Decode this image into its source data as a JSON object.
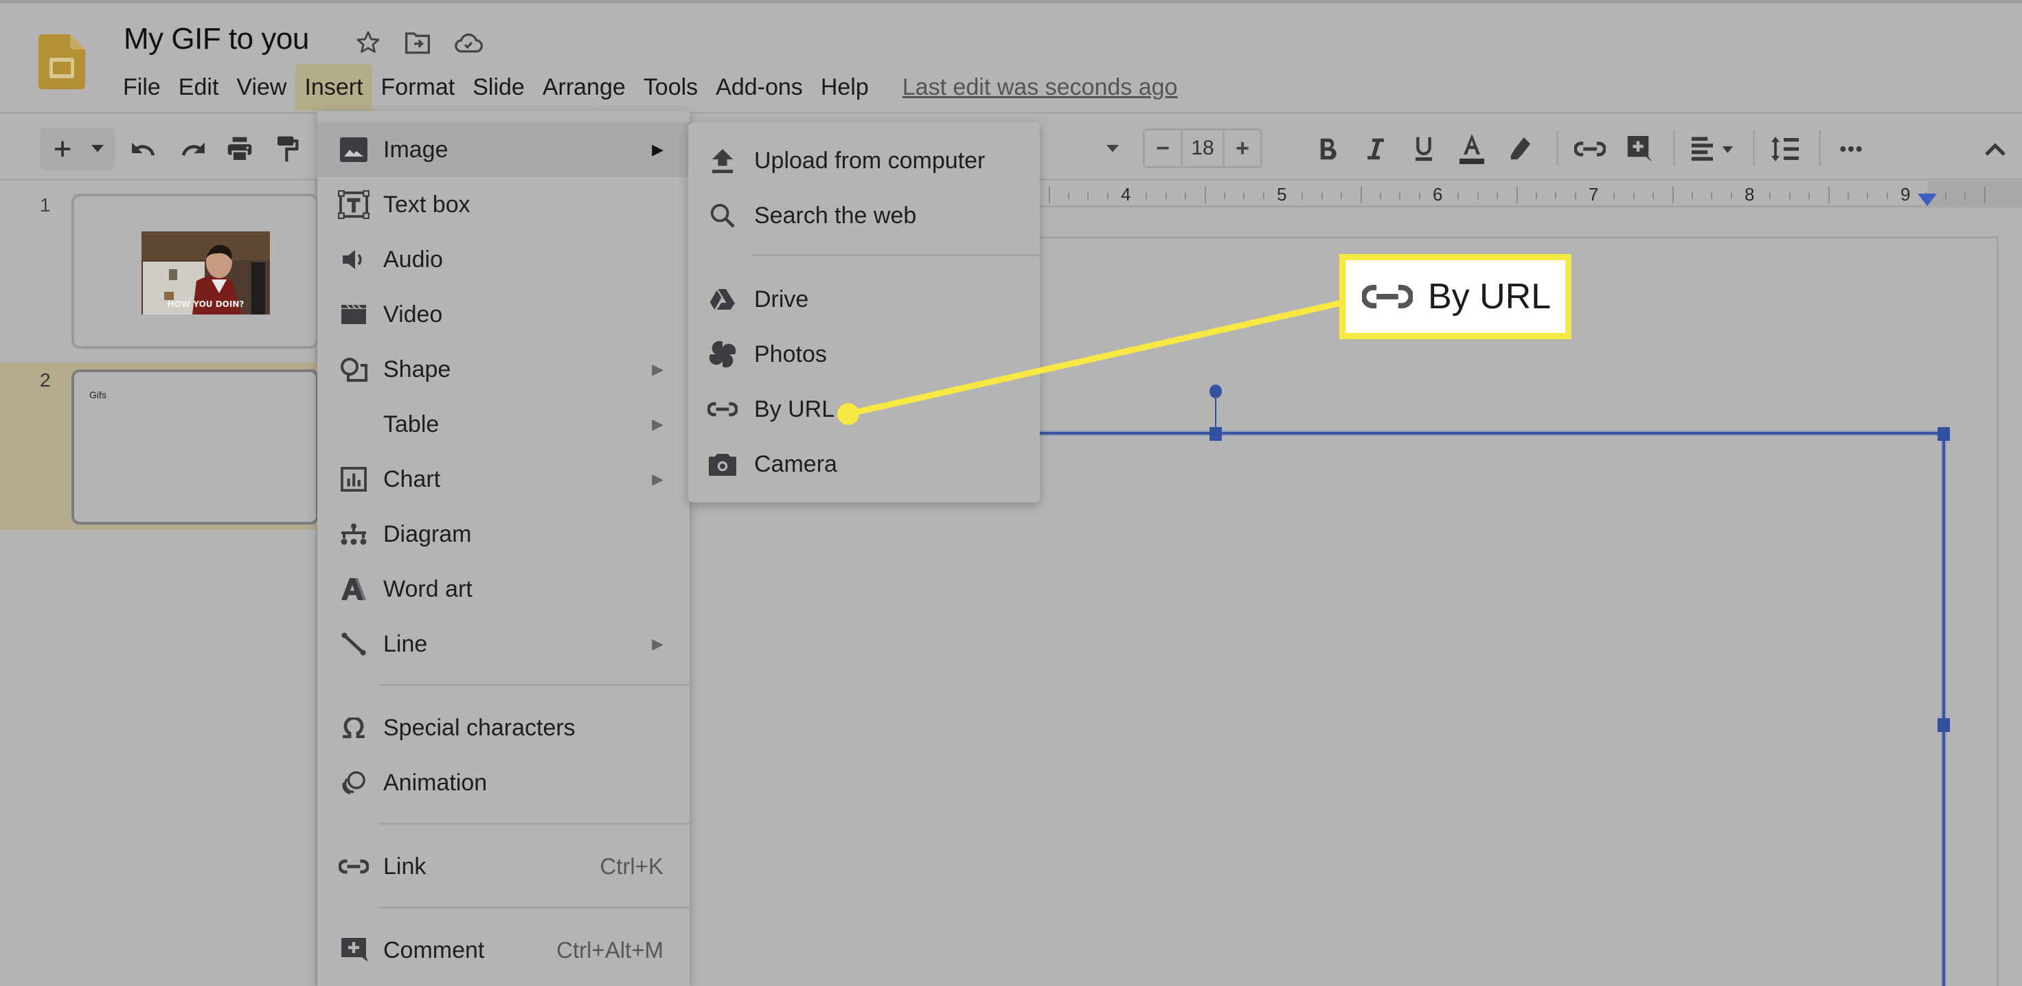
{
  "app": {
    "doc_title": "My GIF to you",
    "title_icons": [
      "star-icon",
      "move-to-folder-icon",
      "cloud-saved-icon"
    ],
    "last_edit": "Last edit was seconds ago"
  },
  "menubar": {
    "items": [
      "File",
      "Edit",
      "View",
      "Insert",
      "Format",
      "Slide",
      "Arrange",
      "Tools",
      "Add-ons",
      "Help"
    ],
    "active": "Insert"
  },
  "toolbar": {
    "left_icons": [
      "new-slide-icon",
      "dropdown-icon",
      "undo-icon",
      "redo-icon",
      "print-icon",
      "paint-format-icon"
    ],
    "font_size": "18",
    "font_size_minus": "−",
    "font_size_plus": "+",
    "format_icons": [
      "bold-icon",
      "italic-icon",
      "underline-icon",
      "text-color-icon",
      "highlight-icon",
      "link-icon",
      "add-comment-icon",
      "align-icon",
      "line-spacing-icon",
      "more-icon",
      "collapse-icon"
    ],
    "text_color": "#333333"
  },
  "ruler": {
    "labels": [
      "4",
      "5",
      "6",
      "7",
      "8",
      "9"
    ]
  },
  "filmstrip": {
    "slides": [
      {
        "number": "1",
        "gif_caption": "HOW YOU DOIN?"
      },
      {
        "number": "2",
        "text": "Gifs",
        "selected": true
      }
    ]
  },
  "insert_menu": {
    "items": [
      {
        "label": "Image",
        "icon": "image-icon",
        "submenu": true,
        "highlighted": true
      },
      {
        "label": "Text box",
        "icon": "text-box-icon"
      },
      {
        "label": "Audio",
        "icon": "audio-icon"
      },
      {
        "label": "Video",
        "icon": "video-icon"
      },
      {
        "label": "Shape",
        "icon": "shape-icon",
        "submenu": true
      },
      {
        "label": "Table",
        "icon": "",
        "submenu": true
      },
      {
        "label": "Chart",
        "icon": "chart-icon",
        "submenu": true
      },
      {
        "label": "Diagram",
        "icon": "diagram-icon"
      },
      {
        "label": "Word art",
        "icon": "word-art-icon"
      },
      {
        "label": "Line",
        "icon": "line-icon",
        "submenu": true
      },
      {
        "label": "Special characters",
        "icon": "omega-icon"
      },
      {
        "label": "Animation",
        "icon": "animation-icon"
      },
      {
        "label": "Link",
        "icon": "link-icon",
        "shortcut": "Ctrl+K"
      },
      {
        "label": "Comment",
        "icon": "comment-icon",
        "shortcut": "Ctrl+Alt+M"
      }
    ]
  },
  "image_submenu": {
    "items": [
      {
        "label": "Upload from computer",
        "icon": "upload-icon"
      },
      {
        "label": "Search the web",
        "icon": "search-icon"
      },
      {
        "label": "Drive",
        "icon": "drive-icon"
      },
      {
        "label": "Photos",
        "icon": "photos-icon"
      },
      {
        "label": "By URL",
        "icon": "link-icon"
      },
      {
        "label": "Camera",
        "icon": "camera-icon"
      }
    ]
  },
  "callout": {
    "label": "By URL",
    "icon": "link-icon",
    "highlight_color": "#f7e844"
  },
  "colors": {
    "selection": "#3b55a5",
    "active_menu": "#b4ad8a",
    "logo": "#c9a23a"
  }
}
